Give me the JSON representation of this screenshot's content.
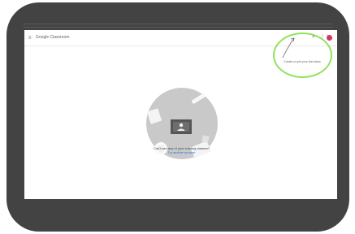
{
  "app": {
    "brand": "Google Classroom"
  },
  "icons": {
    "menu": "menu-icon",
    "add": "plus-icon",
    "apps": "apps-grid-icon",
    "empty_state": "classroom-board-illustration"
  },
  "header": {
    "menu_glyph": "≡",
    "add_glyph": "+",
    "apps_glyph": "⋮⋮"
  },
  "annotation": {
    "hint": "Create or join your first class"
  },
  "empty_state": {
    "message": "Can't see any of your existing classes?",
    "link": "Try another account"
  },
  "colors": {
    "bezel": "#434343",
    "highlight": "#8fe35b",
    "link": "#1a73e8",
    "avatar": "#d93468",
    "illustration_bg": "#c9c9c9"
  }
}
